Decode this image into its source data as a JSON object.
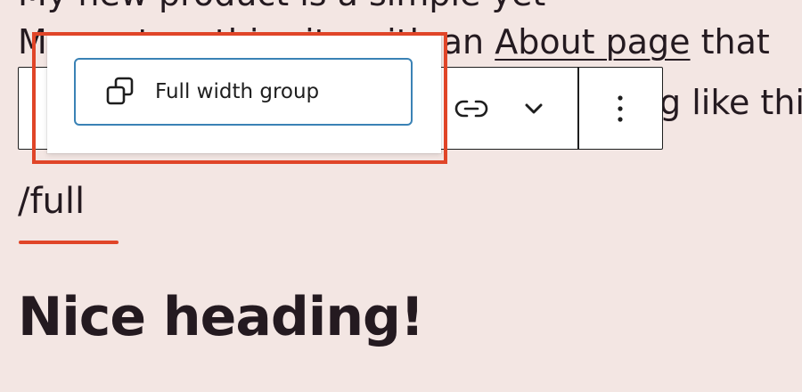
{
  "paragraph": {
    "line_top": "My new product is a simple yet",
    "line_2_before": "My post on this site with an ",
    "line_2_link": "About page",
    "line_2_after": " that",
    "line_3_tail": "g like this"
  },
  "toolbar": {
    "link_icon": "link-icon",
    "chevron_icon": "chevron-down-icon",
    "more_icon": "more-vertical-icon"
  },
  "editor": {
    "slash_command": "/full",
    "heading": "Nice heading!"
  },
  "autocomplete": {
    "option_label": "Full width group",
    "option_icon": "group-icon"
  },
  "colors": {
    "background": "#f3e6e3",
    "text": "#241a20",
    "accent_red": "#e04528",
    "selection_blue": "#3a82b5"
  }
}
